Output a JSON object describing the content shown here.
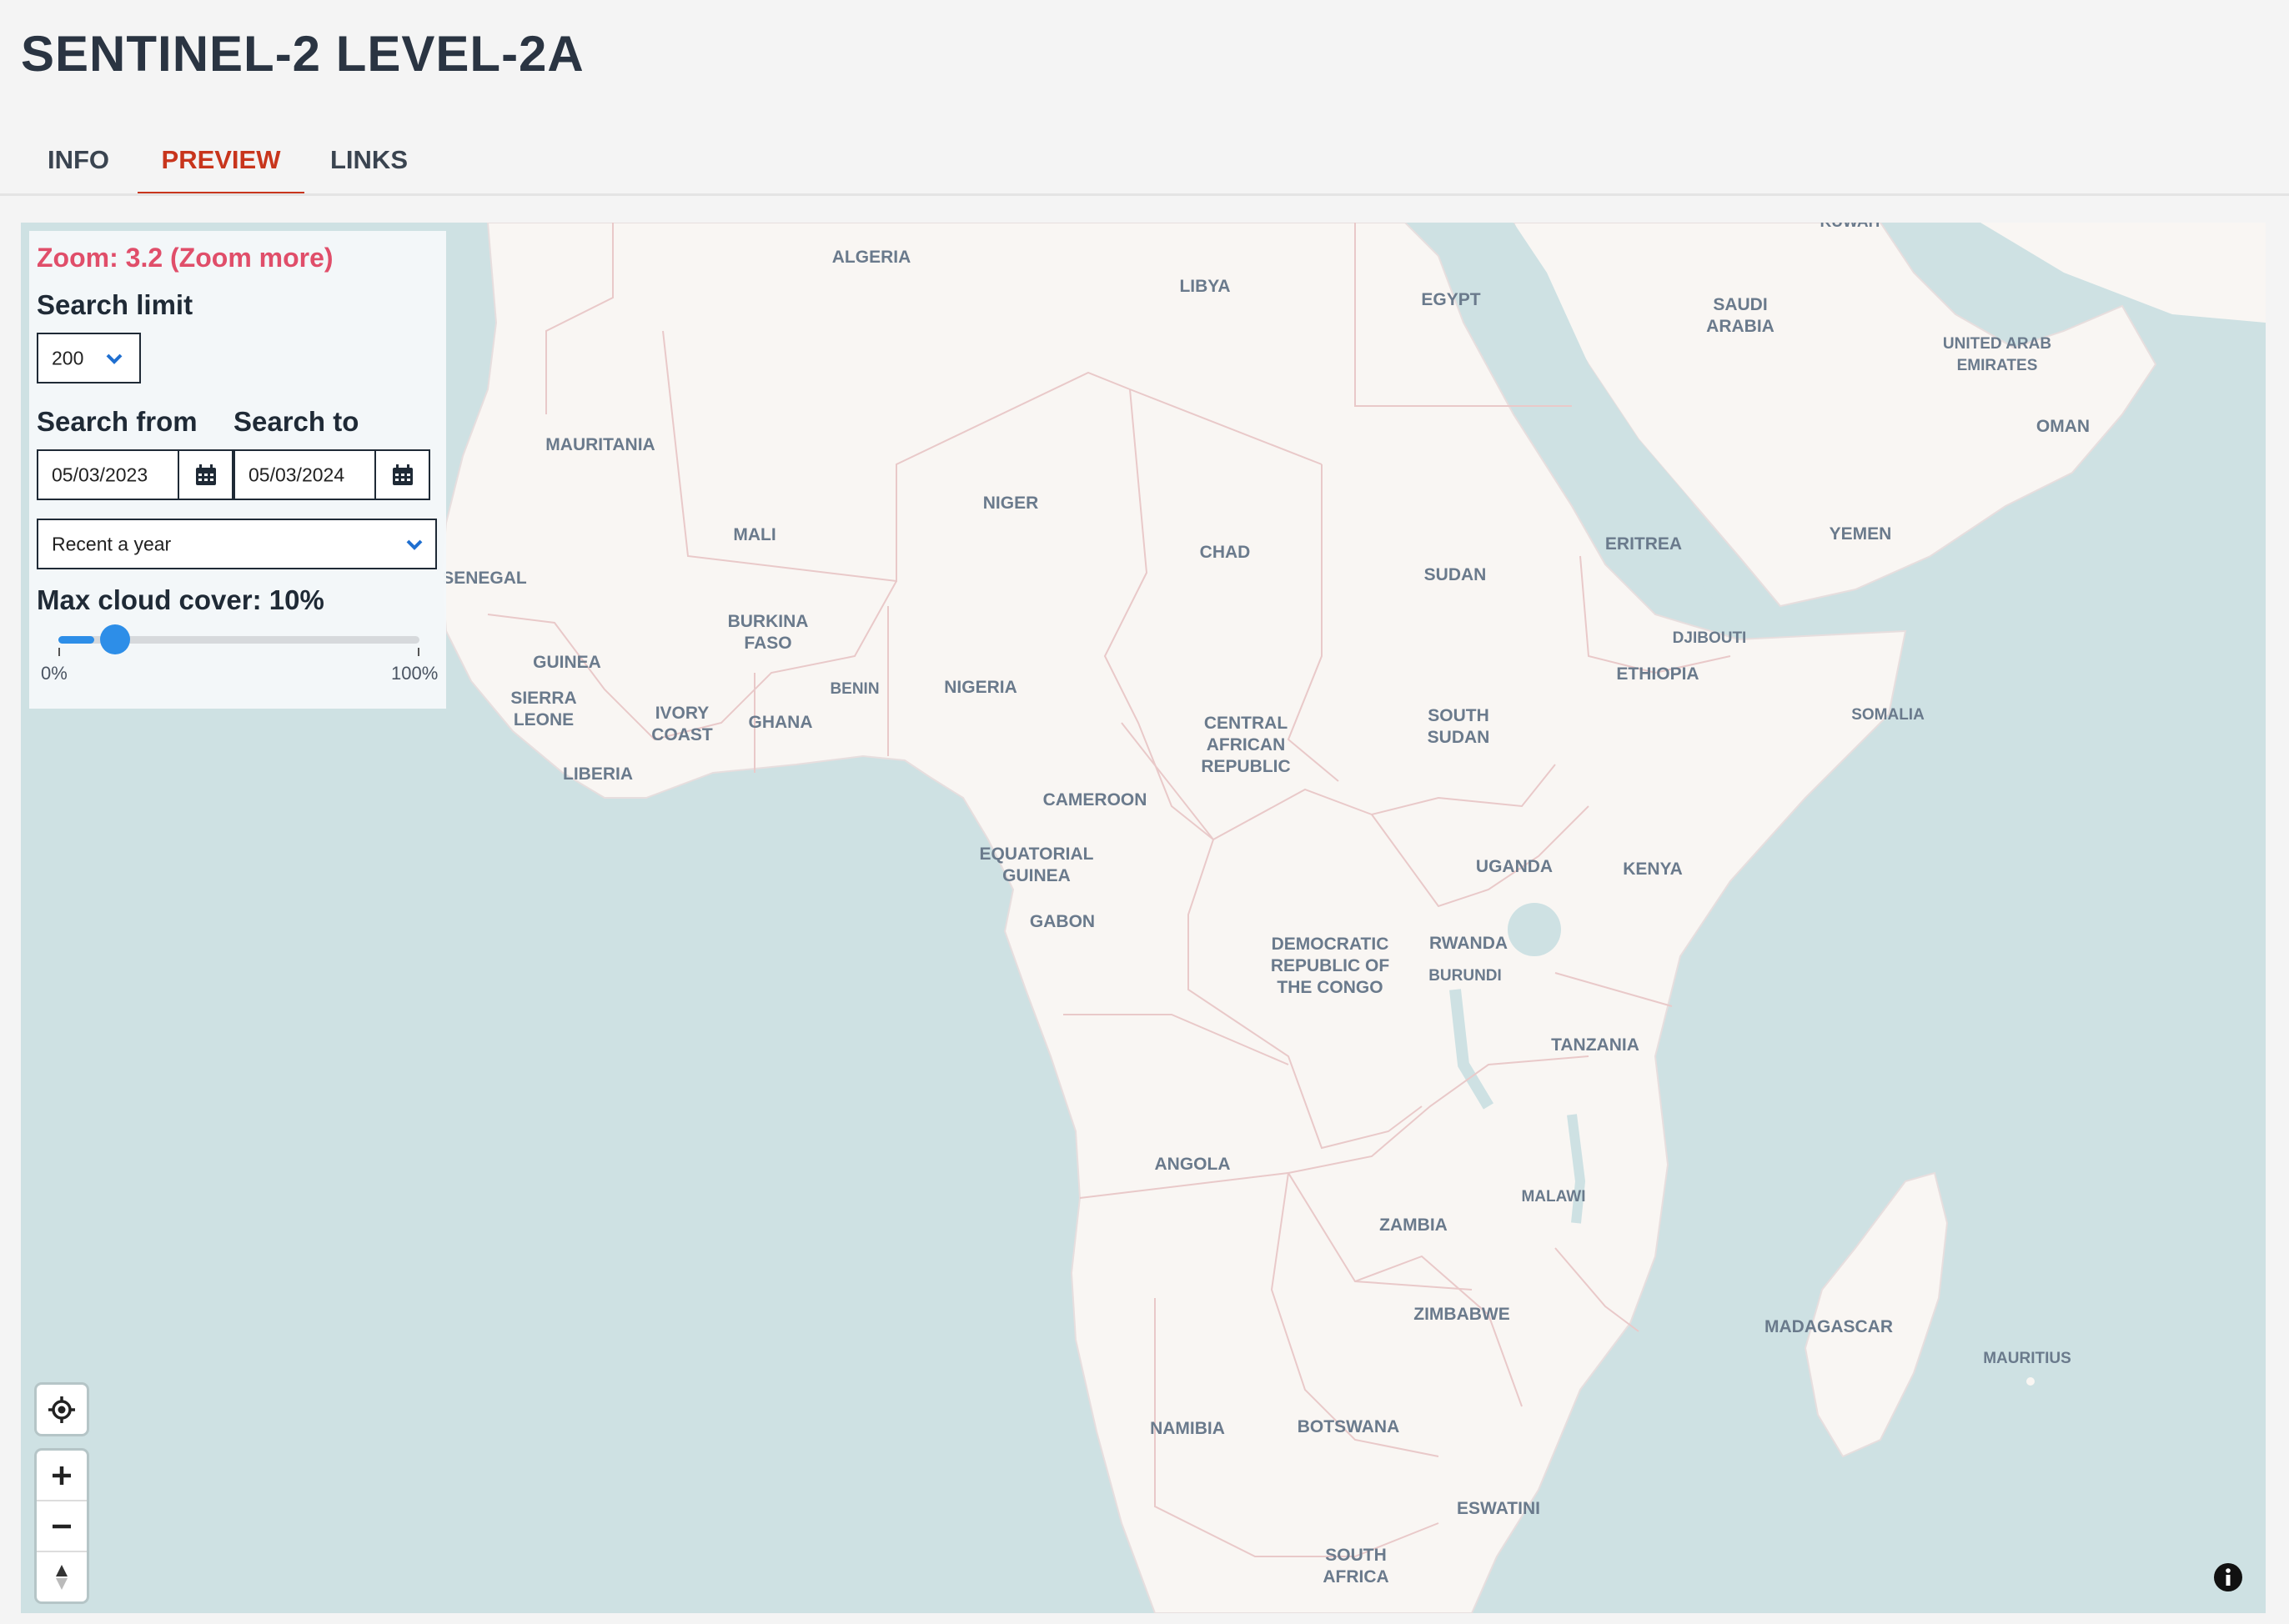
{
  "page": {
    "title": "SENTINEL-2 LEVEL-2A"
  },
  "tabs": [
    {
      "label": "INFO",
      "active": false
    },
    {
      "label": "PREVIEW",
      "active": true
    },
    {
      "label": "LINKS",
      "active": false
    }
  ],
  "panel": {
    "zoom_text": "Zoom: 3.2 (Zoom more)",
    "search_limit_label": "Search limit",
    "search_limit_value": "200",
    "search_from_label": "Search from",
    "search_to_label": "Search to",
    "search_from_value": "05/03/2023",
    "search_to_value": "05/03/2024",
    "preset_value": "Recent a year",
    "cloud_label": "Max cloud cover: 10%",
    "cloud_value_percent": 10,
    "range_min": "0%",
    "range_max": "100%"
  },
  "map": {
    "labels": [
      {
        "text": "ALGERIA"
      },
      {
        "text": "LIBYA"
      },
      {
        "text": "EGYPT"
      },
      {
        "text": "SAUDI\nARABIA"
      },
      {
        "text": "KUWAIT"
      },
      {
        "text": "UNITED ARAB\nEMIRATES"
      },
      {
        "text": "OMAN"
      },
      {
        "text": "MAURITANIA"
      },
      {
        "text": "NIGER"
      },
      {
        "text": "MALI"
      },
      {
        "text": "CHAD"
      },
      {
        "text": "SUDAN"
      },
      {
        "text": "ERITREA"
      },
      {
        "text": "YEMEN"
      },
      {
        "text": "SENEGAL"
      },
      {
        "text": "BURKINA\nFASO"
      },
      {
        "text": "DJIBOUTI"
      },
      {
        "text": "GUINEA"
      },
      {
        "text": "BENIN"
      },
      {
        "text": "NIGERIA"
      },
      {
        "text": "ETHIOPIA"
      },
      {
        "text": "SIERRA\nLEONE"
      },
      {
        "text": "IVORY\nCOAST"
      },
      {
        "text": "GHANA"
      },
      {
        "text": "CENTRAL\nAFRICAN\nREPUBLIC"
      },
      {
        "text": "SOUTH\nSUDAN"
      },
      {
        "text": "SOMALIA"
      },
      {
        "text": "LIBERIA"
      },
      {
        "text": "CAMEROON"
      },
      {
        "text": "EQUATORIAL\nGUINEA"
      },
      {
        "text": "UGANDA"
      },
      {
        "text": "KENYA"
      },
      {
        "text": "GABON"
      },
      {
        "text": "DEMOCRATIC\nREPUBLIC OF\nTHE CONGO"
      },
      {
        "text": "RWANDA"
      },
      {
        "text": "BURUNDI"
      },
      {
        "text": "TANZANIA"
      },
      {
        "text": "ANGOLA"
      },
      {
        "text": "MALAWI"
      },
      {
        "text": "ZAMBIA"
      },
      {
        "text": "ZIMBABWE"
      },
      {
        "text": "MADAGASCAR"
      },
      {
        "text": "MAURITIUS"
      },
      {
        "text": "NAMIBIA"
      },
      {
        "text": "BOTSWANA"
      },
      {
        "text": "ESWATINI"
      },
      {
        "text": "SOUTH\nAFRICA"
      }
    ]
  },
  "colors": {
    "accent": "#c8351c",
    "zoom_warning": "#e04e6a",
    "slider": "#2d8ee8",
    "water": "#cee1e3",
    "land": "#f9f6f3",
    "border": "#e9c9c9"
  },
  "icons": [
    "calendar-icon",
    "chevron-down-icon",
    "locate-icon",
    "zoom-in-icon",
    "zoom-out-icon",
    "compass-icon",
    "info-icon"
  ]
}
